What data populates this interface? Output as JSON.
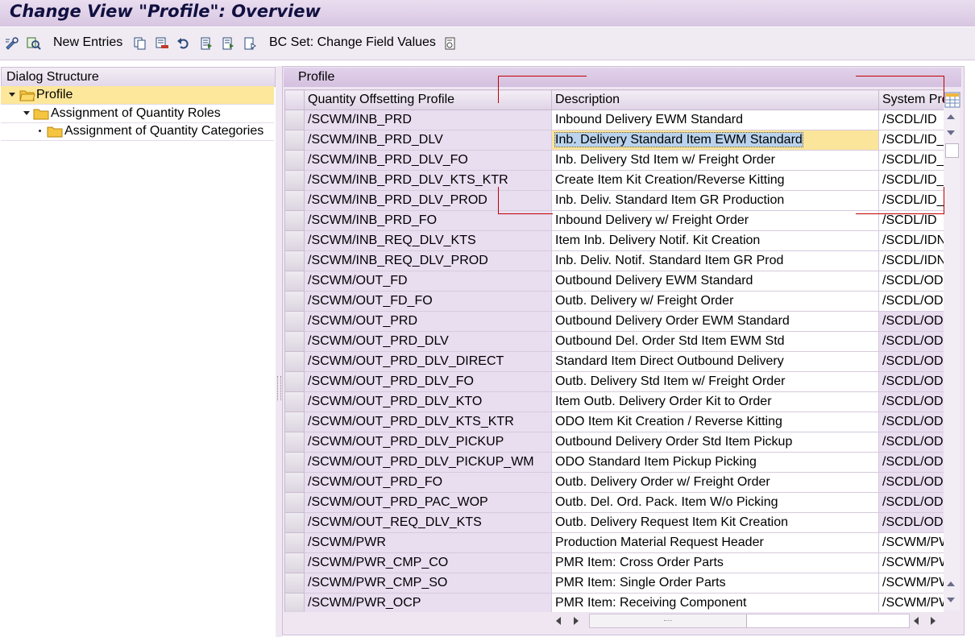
{
  "window": {
    "title": "Change View \"Profile\": Overview"
  },
  "toolbar": {
    "new_entries_label": "New Entries",
    "bc_set_label": "BC Set: Change Field Values"
  },
  "dialog_structure": {
    "header": "Dialog Structure",
    "items": [
      {
        "label": "Profile",
        "selected": true,
        "open": true
      },
      {
        "label": "Assignment of Quantity Roles"
      },
      {
        "label": "Assignment of Quantity Categories"
      }
    ]
  },
  "panel": {
    "title": "Profile"
  },
  "table": {
    "columns": [
      "Quantity Offsetting Profile",
      "Description",
      "System Pro"
    ],
    "rows": [
      [
        "/SCWM/INB_PRD",
        "Inbound Delivery EWM Standard",
        "/SCDL/ID"
      ],
      [
        "/SCWM/INB_PRD_DLV",
        "Inb. Delivery Standard Item EWM Standard",
        "/SCDL/ID_"
      ],
      [
        "/SCWM/INB_PRD_DLV_FO",
        "Inb. Delivery Std Item w/ Freight Order",
        "/SCDL/ID_"
      ],
      [
        "/SCWM/INB_PRD_DLV_KTS_KTR",
        "Create Item Kit Creation/Reverse Kitting",
        "/SCDL/ID_"
      ],
      [
        "/SCWM/INB_PRD_DLV_PROD",
        "Inb. Deliv. Standard Item GR Production",
        "/SCDL/ID_"
      ],
      [
        "/SCWM/INB_PRD_FO",
        "Inbound Delivery w/ Freight Order",
        "/SCDL/ID"
      ],
      [
        "/SCWM/INB_REQ_DLV_KTS",
        "Item Inb. Delivery Notif. Kit Creation",
        "/SCDL/IDN"
      ],
      [
        "/SCWM/INB_REQ_DLV_PROD",
        "Inb. Deliv. Notif. Standard Item GR Prod",
        "/SCDL/IDN"
      ],
      [
        "/SCWM/OUT_FD",
        "Outbound Delivery EWM Standard",
        "/SCDL/OD"
      ],
      [
        "/SCWM/OUT_FD_FO",
        "Outb. Delivery w/ Freight Order",
        "/SCDL/OD"
      ],
      [
        "/SCWM/OUT_PRD",
        "Outbound Delivery Order EWM Standard",
        "/SCDL/ODO"
      ],
      [
        "/SCWM/OUT_PRD_DLV",
        "Outbound Del. Order Std Item EWM Std",
        "/SCDL/ODO"
      ],
      [
        "/SCWM/OUT_PRD_DLV_DIRECT",
        "Standard Item Direct Outbound Delivery",
        "/SCDL/ODO"
      ],
      [
        "/SCWM/OUT_PRD_DLV_FO",
        "Outb. Delivery Std Item w/ Freight Order",
        "/SCDL/ODO"
      ],
      [
        "/SCWM/OUT_PRD_DLV_KTO",
        "Item Outb. Delivery Order Kit to Order",
        "/SCDL/ODO"
      ],
      [
        "/SCWM/OUT_PRD_DLV_KTS_KTR",
        "ODO Item Kit Creation / Reverse Kitting",
        "/SCDL/ODO"
      ],
      [
        "/SCWM/OUT_PRD_DLV_PICKUP",
        "Outbound Delivery Order Std Item Pickup",
        "/SCDL/ODO"
      ],
      [
        "/SCWM/OUT_PRD_DLV_PICKUP_WM",
        "ODO Standard Item Pickup Picking",
        "/SCDL/ODO"
      ],
      [
        "/SCWM/OUT_PRD_FO",
        "Outb. Delivery Order w/ Freight Order",
        "/SCDL/ODO"
      ],
      [
        "/SCWM/OUT_PRD_PAC_WOP",
        "Outb. Del. Ord. Pack. Item W/o Picking",
        "/SCDL/ODO"
      ],
      [
        "/SCWM/OUT_REQ_DLV_KTS",
        "Outb. Delivery Request Item Kit Creation",
        "/SCDL/ODR"
      ],
      [
        "/SCWM/PWR",
        "Production Material Request Header",
        "/SCWM/PW"
      ],
      [
        "/SCWM/PWR_CMP_CO",
        "PMR Item: Cross Order Parts",
        "/SCWM/PW"
      ],
      [
        "/SCWM/PWR_CMP_SO",
        "PMR Item: Single Order Parts",
        "/SCWM/PW"
      ],
      [
        "/SCWM/PWR_OCP",
        "PMR Item: Receiving Component",
        "/SCWM/PW"
      ]
    ],
    "focused_row": 1,
    "highlight_color": "#fbe59b"
  }
}
